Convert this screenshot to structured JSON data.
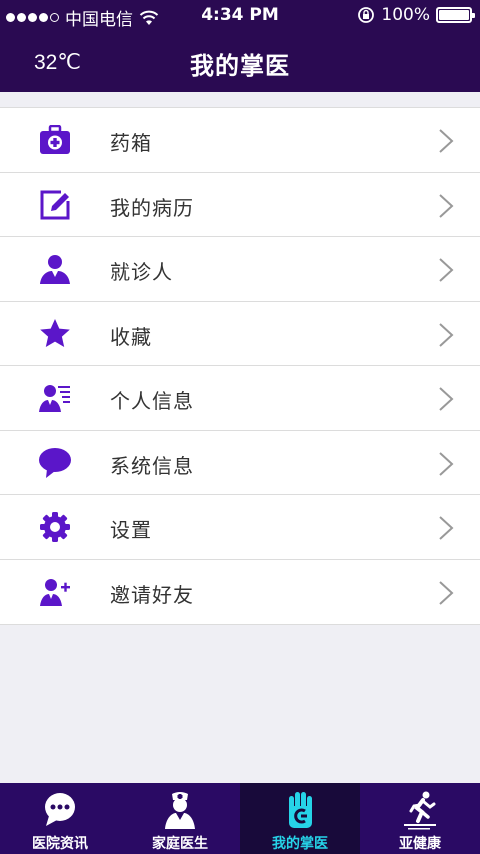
{
  "status_bar": {
    "carrier": "中国电信",
    "time": "4:34 PM",
    "battery": "100%",
    "battery_level": 1.0
  },
  "header": {
    "temperature": "32℃",
    "title": "我的掌医"
  },
  "menu": {
    "items": [
      {
        "label": "药箱",
        "icon": "medicine-box-icon"
      },
      {
        "label": "我的病历",
        "icon": "edit-record-icon"
      },
      {
        "label": "就诊人",
        "icon": "patient-icon"
      },
      {
        "label": "收藏",
        "icon": "star-icon"
      },
      {
        "label": "个人信息",
        "icon": "personal-info-icon"
      },
      {
        "label": "系统信息",
        "icon": "message-bubble-icon"
      },
      {
        "label": "设置",
        "icon": "gear-icon"
      },
      {
        "label": "邀请好友",
        "icon": "add-friend-icon"
      }
    ]
  },
  "tabbar": {
    "tabs": [
      {
        "label": "医院资讯",
        "icon": "chat-bubble-icon",
        "active": false
      },
      {
        "label": "家庭医生",
        "icon": "doctor-icon",
        "active": false
      },
      {
        "label": "我的掌医",
        "icon": "palm-icon",
        "active": true
      },
      {
        "label": "亚健康",
        "icon": "running-icon",
        "active": false
      }
    ]
  },
  "colors": {
    "header_bg": "#2a0a52",
    "accent": "#5b16c9",
    "tabbar_bg": "#2a0a64",
    "tab_active": "#26d3e8"
  }
}
